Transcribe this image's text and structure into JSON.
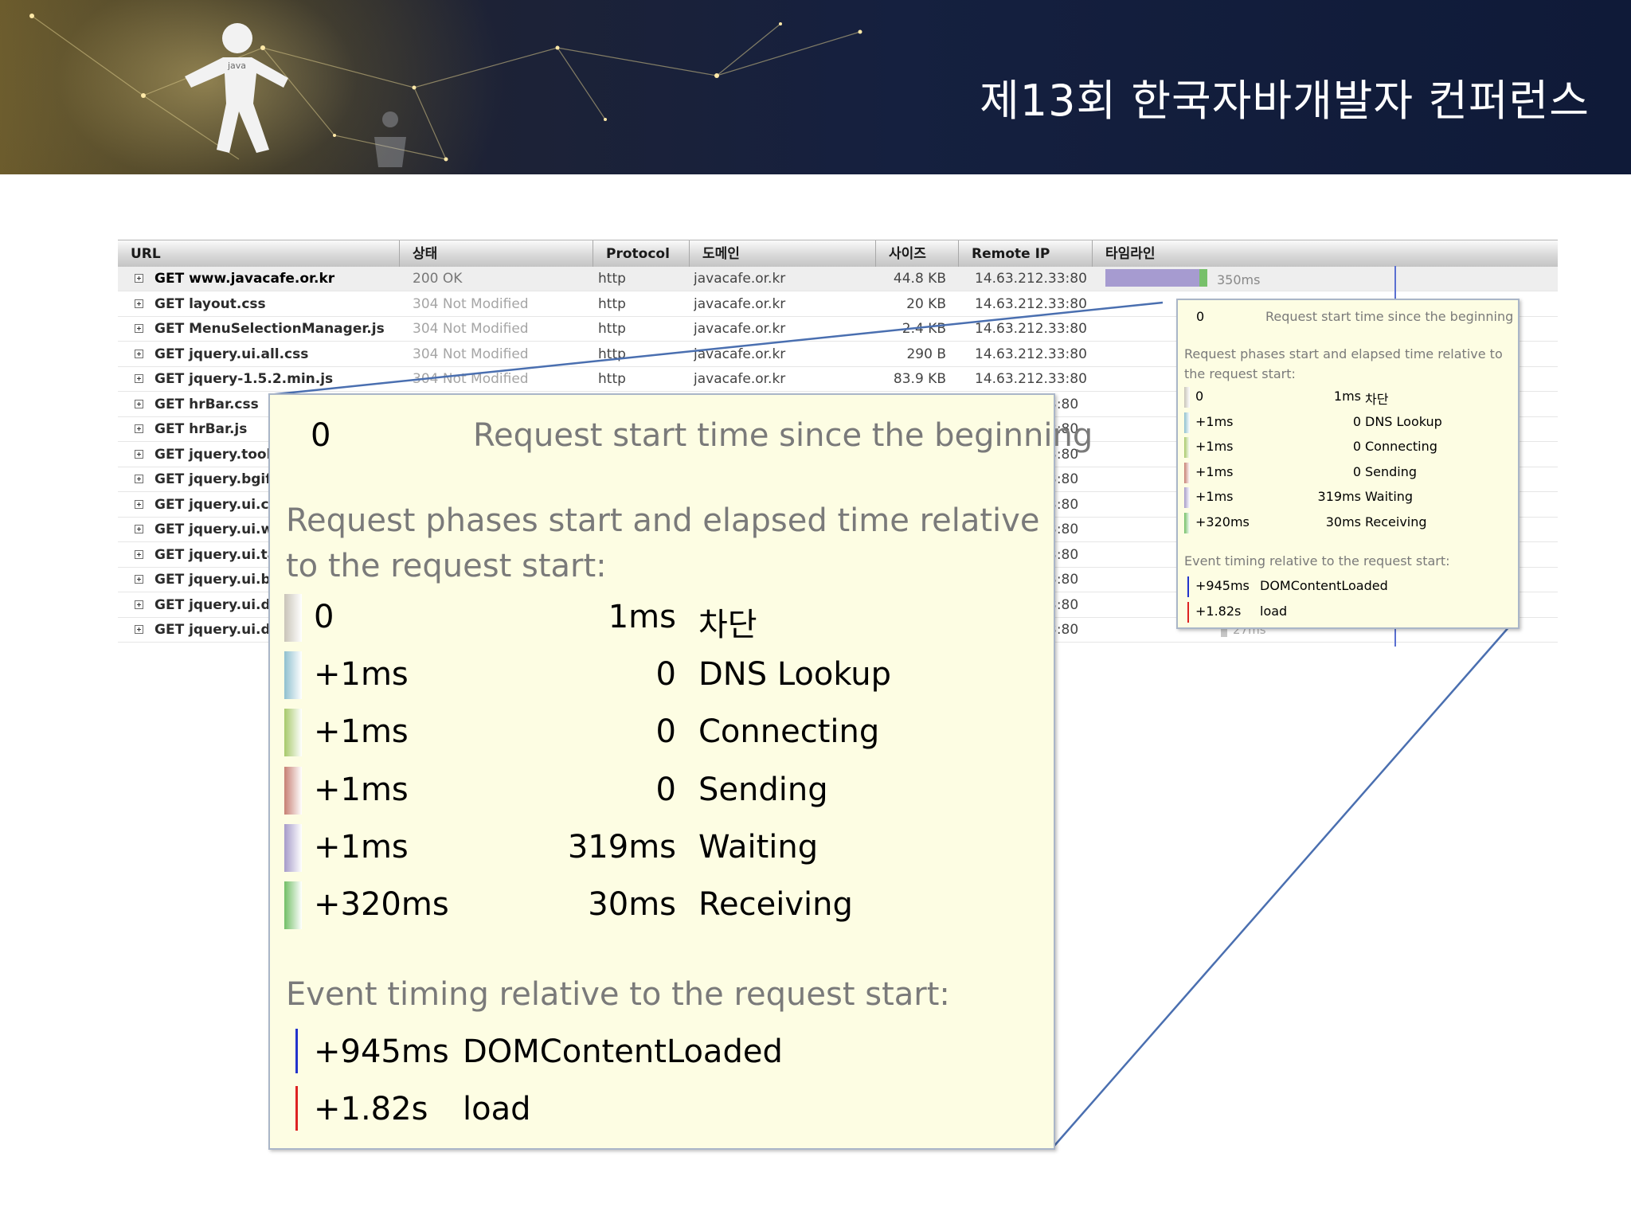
{
  "slide": {
    "title": "제13회 한국자바개발자 컨퍼런스",
    "logo_text": "java"
  },
  "table": {
    "columns": {
      "url": "URL",
      "status": "상태",
      "protocol": "Protocol",
      "domain": "도메인",
      "size": "사이즈",
      "remote_ip": "Remote IP",
      "timeline": "타임라인"
    },
    "rows": [
      {
        "method": "GET",
        "url": "www.javacafe.or.kr",
        "status": "200 OK",
        "protocol": "http",
        "domain": "javacafe.or.kr",
        "size": "44.8 KB",
        "ip": "14.63.212.33:80"
      },
      {
        "method": "GET",
        "url": "layout.css",
        "status": "304 Not Modified",
        "protocol": "http",
        "domain": "javacafe.or.kr",
        "size": "20 KB",
        "ip": "14.63.212.33:80"
      },
      {
        "method": "GET",
        "url": "MenuSelectionManager.js",
        "status": "304 Not Modified",
        "protocol": "http",
        "domain": "javacafe.or.kr",
        "size": "2.4 KB",
        "ip": "14.63.212.33:80"
      },
      {
        "method": "GET",
        "url": "jquery.ui.all.css",
        "status": "304 Not Modified",
        "protocol": "http",
        "domain": "javacafe.or.kr",
        "size": "290 B",
        "ip": "14.63.212.33:80"
      },
      {
        "method": "GET",
        "url": "jquery-1.5.2.min.js",
        "status": "304 Not Modified",
        "protocol": "http",
        "domain": "javacafe.or.kr",
        "size": "83.9 KB",
        "ip": "14.63.212.33:80"
      },
      {
        "method": "GET",
        "url": "hrBar.css",
        "ip": "3:80"
      },
      {
        "method": "GET",
        "url": "hrBar.js",
        "ip": "3:80"
      },
      {
        "method": "GET",
        "url": "jquery.tool",
        "ip": "3:80"
      },
      {
        "method": "GET",
        "url": "jquery.bgif",
        "ip": "3:80"
      },
      {
        "method": "GET",
        "url": "jquery.ui.c",
        "ip": "3:80"
      },
      {
        "method": "GET",
        "url": "jquery.ui.w",
        "ip": "3:80"
      },
      {
        "method": "GET",
        "url": "jquery.ui.ta",
        "ip": "3:80"
      },
      {
        "method": "GET",
        "url": "jquery.ui.b",
        "ip": "3:80"
      },
      {
        "method": "GET",
        "url": "jquery.ui.d",
        "ip": "3:80"
      },
      {
        "method": "GET",
        "url": "jquery.ui.d",
        "ip": "3:80"
      }
    ],
    "timeline_first_label": "350ms",
    "timeline_last_label": "27ms"
  },
  "tooltip": {
    "start_value": "0",
    "start_label": "Request start time since the beginning",
    "phases_heading": "Request phases start and elapsed time relative to the request start:",
    "phases": [
      {
        "start": "0",
        "elapsed": "1ms",
        "name": "차단",
        "color": "#c9c4b8"
      },
      {
        "start": "+1ms",
        "elapsed": "0",
        "name": "DNS Lookup",
        "color": "#8fc0cf"
      },
      {
        "start": "+1ms",
        "elapsed": "0",
        "name": "Connecting",
        "color": "#a7c96a"
      },
      {
        "start": "+1ms",
        "elapsed": "0",
        "name": "Sending",
        "color": "#c77f73"
      },
      {
        "start": "+1ms",
        "elapsed": "319ms",
        "name": "Waiting",
        "color": "#a69bc9"
      },
      {
        "start": "+320ms",
        "elapsed": "30ms",
        "name": "Receiving",
        "color": "#72bf66"
      }
    ],
    "events_heading": "Event timing relative to the request start:",
    "events": [
      {
        "time": "+945ms",
        "name": "DOMContentLoaded",
        "color": "#2233cc"
      },
      {
        "time": "+1.82s",
        "name": "load",
        "color": "#dd2222"
      }
    ]
  },
  "colors": {
    "banner_text": "#ffffff",
    "tooltip_bg": "#fdfde3",
    "tooltip_border": "#aab6c8",
    "connector_line": "#4a6fb0",
    "timeline_marker": "#5a6fd1"
  }
}
